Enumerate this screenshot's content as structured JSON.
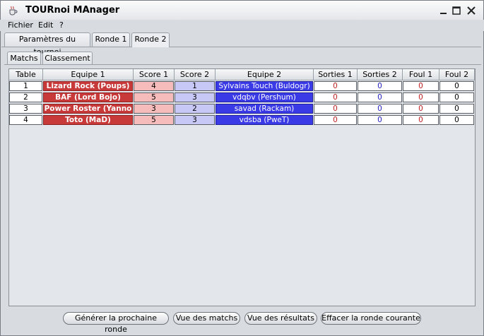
{
  "window": {
    "title": "TOURnoi MAnager"
  },
  "menu": [
    "Fichier",
    "Edit",
    "?"
  ],
  "tabs": [
    "Paramètres du tournoi",
    "Ronde 1",
    "Ronde 2"
  ],
  "subtabs": [
    "Matchs",
    "Classement"
  ],
  "table": {
    "headers": [
      "Table",
      "Equipe 1",
      "Score 1",
      "Score 2",
      "Equipe 2",
      "Sorties 1",
      "Sorties 2",
      "Foul 1",
      "Foul 2"
    ],
    "rows": [
      {
        "table": "1",
        "team1": "Lizard Rock (Poups)",
        "score1": "4",
        "score2": "1",
        "team2": "Sylvains Touch (Buldogr)",
        "sorties1": "0",
        "sorties2": "0",
        "foul1": "0",
        "foul2": "0"
      },
      {
        "table": "2",
        "team1": "BAF (Lord Bojo)",
        "score1": "5",
        "score2": "3",
        "team2": "vdqbv (Pershum)",
        "sorties1": "0",
        "sorties2": "0",
        "foul1": "0",
        "foul2": "0"
      },
      {
        "table": "3",
        "team1": "Power Roster (Yanno",
        "score1": "3",
        "score2": "2",
        "team2": "savad (Rackam)",
        "sorties1": "0",
        "sorties2": "0",
        "foul1": "0",
        "foul2": "0"
      },
      {
        "table": "4",
        "team1": "Toto (MaD)",
        "score1": "5",
        "score2": "3",
        "team2": "vdsba (PweT)",
        "sorties1": "0",
        "sorties2": "0",
        "foul1": "0",
        "foul2": "0"
      }
    ]
  },
  "buttons": {
    "generate": "Générer la prochaine ronde",
    "matches_view": "Vue des matchs",
    "results_view": "Vue des résultats",
    "clear_round": "Effacer la ronde courante"
  },
  "colors": {
    "team1": "#c83a3a",
    "team2": "#3a3ae6",
    "score1": "#f6bcbc",
    "score2": "#c8c8f6"
  },
  "icons": [
    "java-cup-icon",
    "minimize-icon",
    "maximize-icon",
    "close-icon"
  ]
}
